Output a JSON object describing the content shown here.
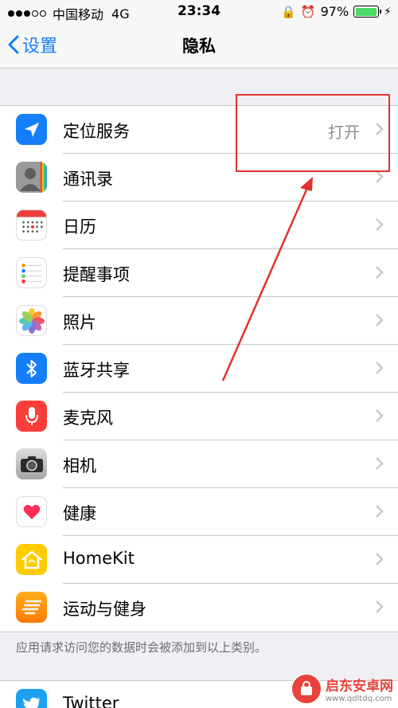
{
  "status_bar": {
    "carrier": "中国移动",
    "network": "4G",
    "time": "23:34",
    "battery_percent": "97%",
    "battery_level": 0.97
  },
  "nav": {
    "back_label": "设置",
    "title": "隐私"
  },
  "rows": [
    {
      "label": "定位服务",
      "value": "打开",
      "icon": "location-arrow-icon"
    },
    {
      "label": "通讯录",
      "value": "",
      "icon": "contacts-icon"
    },
    {
      "label": "日历",
      "value": "",
      "icon": "calendar-icon"
    },
    {
      "label": "提醒事项",
      "value": "",
      "icon": "reminders-icon"
    },
    {
      "label": "照片",
      "value": "",
      "icon": "photos-icon"
    },
    {
      "label": "蓝牙共享",
      "value": "",
      "icon": "bluetooth-icon"
    },
    {
      "label": "麦克风",
      "value": "",
      "icon": "microphone-icon"
    },
    {
      "label": "相机",
      "value": "",
      "icon": "camera-icon"
    },
    {
      "label": "健康",
      "value": "",
      "icon": "health-heart-icon"
    },
    {
      "label": "HomeKit",
      "value": "",
      "icon": "homekit-house-icon"
    },
    {
      "label": "运动与健身",
      "value": "",
      "icon": "motion-fitness-icon"
    }
  ],
  "footer_note": "应用请求访问您的数据时会被添加到以上类别。",
  "group2": {
    "rows": [
      {
        "label": "Twitter",
        "icon": "twitter-bird-icon"
      }
    ]
  },
  "watermark": {
    "name": "启东安卓网",
    "url": "www.qdltdq.com"
  },
  "colors": {
    "ios_blue": "#157efb",
    "annotation_red": "#e0322f",
    "separator": "#c8c7cc",
    "background": "#efeff4"
  }
}
